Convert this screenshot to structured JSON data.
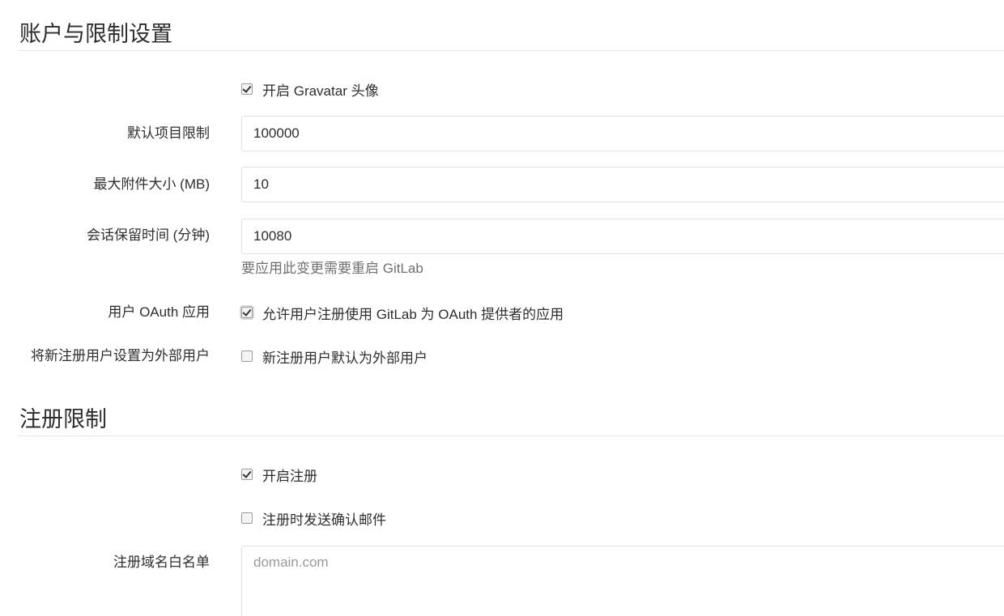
{
  "account_section": {
    "title": "账户与限制设置",
    "gravatar": {
      "label": "开启 Gravatar 头像",
      "checked": true
    },
    "default_projects_limit": {
      "label": "默认项目限制",
      "value": "100000"
    },
    "max_attachment_size": {
      "label": "最大附件大小 (MB)",
      "value": "10"
    },
    "session_expire": {
      "label": "会话保留时间 (分钟)",
      "value": "10080",
      "help": "要应用此变更需要重启 GitLab"
    },
    "user_oauth": {
      "label": "用户 OAuth 应用",
      "checkbox_label": "允许用户注册使用 GitLab 为 OAuth 提供者的应用",
      "checked": true
    },
    "external_users": {
      "label": "将新注册用户设置为外部用户",
      "checkbox_label": "新注册用户默认为外部用户",
      "checked": false
    }
  },
  "signup_section": {
    "title": "注册限制",
    "signup_enabled": {
      "label": "开启注册",
      "checked": true
    },
    "send_confirmation": {
      "label": "注册时发送确认邮件",
      "checked": false
    },
    "domain_whitelist": {
      "label": "注册域名白名单",
      "placeholder": "domain.com",
      "value": ""
    }
  }
}
